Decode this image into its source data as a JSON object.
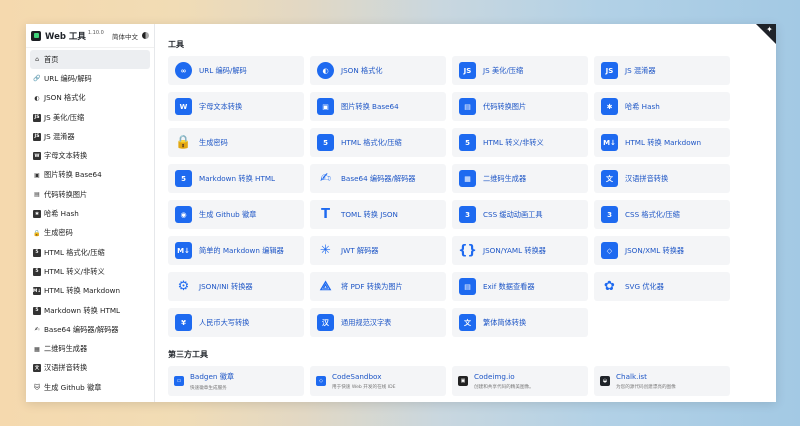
{
  "app": {
    "title": "Web 工具",
    "version": "1.10.0",
    "language_label": "简体中文"
  },
  "sidebar": {
    "items": [
      {
        "label": "首页",
        "icon": "home-icon",
        "active": true
      },
      {
        "label": "URL 编码/解码",
        "icon": "link-icon"
      },
      {
        "label": "JSON 格式化",
        "icon": "json-icon"
      },
      {
        "label": "JS 美化/压缩",
        "icon": "js-icon"
      },
      {
        "label": "JS 混淆器",
        "icon": "js-icon"
      },
      {
        "label": "字母文本转换",
        "icon": "word-icon"
      },
      {
        "label": "图片转换 Base64",
        "icon": "image-icon"
      },
      {
        "label": "代码转换图片",
        "icon": "file-image-icon"
      },
      {
        "label": "哈希 Hash",
        "icon": "hash-icon"
      },
      {
        "label": "生成密码",
        "icon": "lock-icon"
      },
      {
        "label": "HTML 格式化/压缩",
        "icon": "html5-icon"
      },
      {
        "label": "HTML 转义/非转义",
        "icon": "html5-icon"
      },
      {
        "label": "HTML 转换 Markdown",
        "icon": "markdown-icon"
      },
      {
        "label": "Markdown 转换 HTML",
        "icon": "html5-icon"
      },
      {
        "label": "Base64 编码器/解码器",
        "icon": "signature-icon"
      },
      {
        "label": "二维码生成器",
        "icon": "qrcode-icon"
      },
      {
        "label": "汉语拼音转换",
        "icon": "translate-icon"
      },
      {
        "label": "生成 Github 徽章",
        "icon": "github-icon"
      }
    ]
  },
  "tools": {
    "title": "工具",
    "items": [
      {
        "label": "URL 编码/解码",
        "icon": "link-icon"
      },
      {
        "label": "JSON 格式化",
        "icon": "json-icon"
      },
      {
        "label": "JS 美化/压缩",
        "icon": "js-icon"
      },
      {
        "label": "JS 混淆器",
        "icon": "js-icon"
      },
      {
        "label": "字母文本转换",
        "icon": "word-icon"
      },
      {
        "label": "图片转换 Base64",
        "icon": "image-icon"
      },
      {
        "label": "代码转换图片",
        "icon": "file-image-icon"
      },
      {
        "label": "哈希 Hash",
        "icon": "hash-icon"
      },
      {
        "label": "生成密码",
        "icon": "lock-icon"
      },
      {
        "label": "HTML 格式化/压缩",
        "icon": "html5-icon"
      },
      {
        "label": "HTML 转义/非转义",
        "icon": "html5-icon"
      },
      {
        "label": "HTML 转换 Markdown",
        "icon": "markdown-icon"
      },
      {
        "label": "Markdown 转换 HTML",
        "icon": "html5-icon"
      },
      {
        "label": "Base64 编码器/解码器",
        "icon": "signature-icon"
      },
      {
        "label": "二维码生成器",
        "icon": "qrcode-icon"
      },
      {
        "label": "汉语拼音转换",
        "icon": "translate-icon"
      },
      {
        "label": "生成 Github 徽章",
        "icon": "github-icon"
      },
      {
        "label": "TOML 转换 JSON",
        "icon": "toml-icon"
      },
      {
        "label": "CSS 缓动动画工具",
        "icon": "css3-icon"
      },
      {
        "label": "CSS 格式化/压缩",
        "icon": "css3-icon"
      },
      {
        "label": "简单的 Markdown 编辑器",
        "icon": "markdown-icon"
      },
      {
        "label": "JWT 解码器",
        "icon": "jwt-icon"
      },
      {
        "label": "JSON/YAML 转换器",
        "icon": "code-braces-icon"
      },
      {
        "label": "JSON/XML 转换器",
        "icon": "xml-icon"
      },
      {
        "label": "JSON/INI 转换器",
        "icon": "gear-icon"
      },
      {
        "label": "将 PDF 转换为图片",
        "icon": "pdf-icon"
      },
      {
        "label": "Exif 数据查看器",
        "icon": "exif-icon"
      },
      {
        "label": "SVG 优化器",
        "icon": "svg-icon"
      },
      {
        "label": "人民币大写转换",
        "icon": "yuan-icon"
      },
      {
        "label": "通用规范汉字表",
        "icon": "han-icon"
      },
      {
        "label": "繁体简体转换",
        "icon": "translate-icon"
      }
    ]
  },
  "third_party": {
    "title": "第三方工具",
    "items": [
      {
        "label": "Badgen 徽章",
        "desc": "快速徽章生成服务",
        "icon": "badgen-icon",
        "color": "#1e6af0"
      },
      {
        "label": "CodeSandbox",
        "desc": "用于快速 Web 开发的在线 IDE",
        "icon": "codesandbox-icon",
        "color": "#1e6af0"
      },
      {
        "label": "Codeimg.io",
        "desc": "创建和共享代码的精美图像。",
        "icon": "codeimg-icon",
        "color": "#222222"
      },
      {
        "label": "Chalk.ist",
        "desc": "为您的源代码创建漂亮的图像",
        "icon": "chalkist-icon",
        "color": "#1f2329"
      }
    ]
  },
  "colors": {
    "accent": "#1e6af0",
    "link": "#1e56c6",
    "card": "#f4f5f7"
  }
}
